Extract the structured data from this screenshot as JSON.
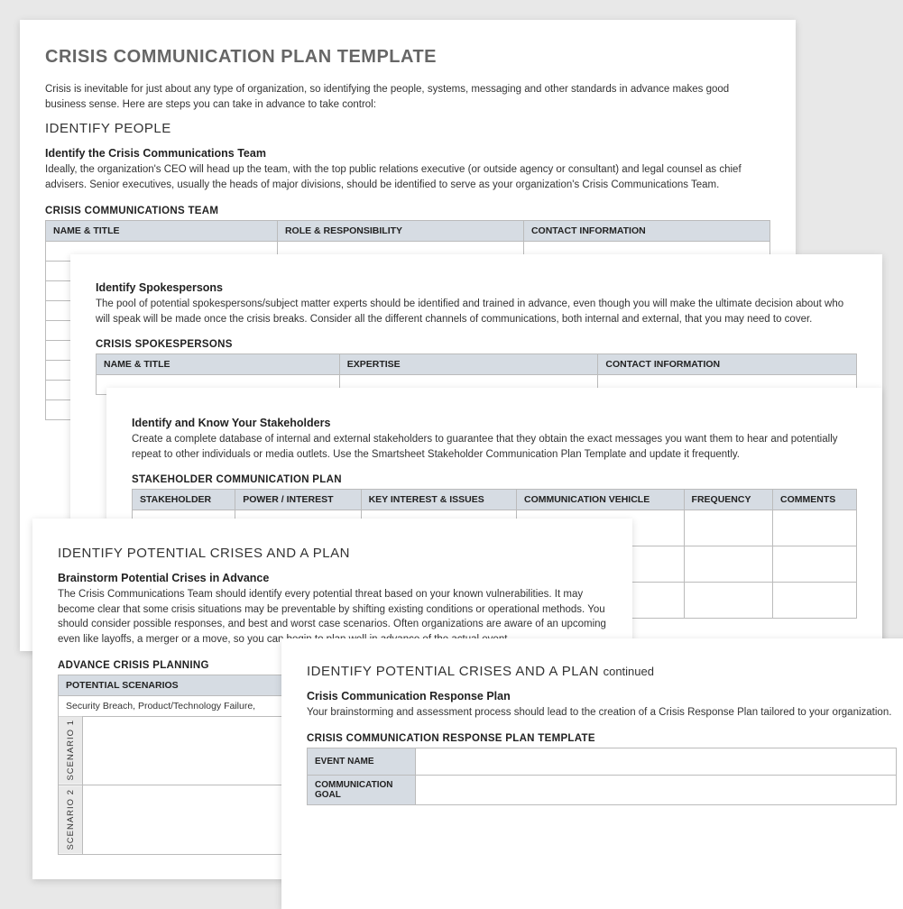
{
  "p1": {
    "title": "CRISIS COMMUNICATION PLAN TEMPLATE",
    "intro": "Crisis is inevitable for just about any type of organization, so identifying the people, systems, messaging and other standards in advance makes good business sense. Here are steps you can take in advance to take control:",
    "sec1": "IDENTIFY PEOPLE",
    "sub1": "Identify the Crisis Communications Team",
    "body1": "Ideally, the organization's CEO will head up the team, with the top public relations executive (or outside agency or consultant) and legal counsel as chief advisers. Senior executives, usually the heads of major divisions, should be identified to serve as your organization's Crisis Communications Team.",
    "tbl1_title": "CRISIS COMMUNICATIONS TEAM",
    "tbl1_h1": "NAME & TITLE",
    "tbl1_h2": "ROLE & RESPONSIBILITY",
    "tbl1_h3": "CONTACT INFORMATION"
  },
  "p2": {
    "sub": "Identify Spokespersons",
    "body": "The pool of potential spokespersons/subject matter experts should be identified and trained in advance, even though you will make the ultimate decision about who will speak will be made once the crisis breaks. Consider all the different channels of communications, both internal and external, that you may need to cover.",
    "tbl_title": "CRISIS SPOKESPERSONS",
    "h1": "NAME & TITLE",
    "h2": "EXPERTISE",
    "h3": "CONTACT INFORMATION"
  },
  "p3": {
    "sub": "Identify and Know Your Stakeholders",
    "body": "Create a complete database of internal and external stakeholders to guarantee that they obtain the exact messages you want them to hear and potentially repeat to other individuals or media outlets. Use the Smartsheet Stakeholder Communication Plan Template and update it frequently.",
    "tbl_title": "STAKEHOLDER COMMUNICATION PLAN",
    "h1": "STAKEHOLDER",
    "h2": "POWER / INTEREST",
    "h3": "KEY INTEREST & ISSUES",
    "h4": "COMMUNICATION VEHICLE",
    "h5": "FREQUENCY",
    "h6": "COMMENTS"
  },
  "p4": {
    "sec": "IDENTIFY POTENTIAL CRISES AND A PLAN",
    "sub": "Brainstorm Potential Crises in Advance",
    "body": "The Crisis Communications Team should identify every potential threat based on your known vulnerabilities. It may become clear that some crisis situations may be preventable by shifting existing conditions or operational methods. You should consider possible responses, and best and worst case scenarios. Often organizations are aware of an upcoming even like layoffs, a merger or a move, so you can begin to plan well in advance of the actual event.",
    "tbl_title": "ADVANCE CRISIS PLANNING",
    "h1": "POTENTIAL SCENARIOS",
    "row1": "Security Breach, Product/Technology Failure,",
    "s1": "SCENARIO 1",
    "s2": "SCENARIO 2"
  },
  "p5": {
    "sec": "IDENTIFY POTENTIAL CRISES AND A PLAN",
    "cont": "continued",
    "sub": "Crisis Communication Response Plan",
    "body": "Your brainstorming and assessment process should lead to the creation of a Crisis Response Plan tailored to your organization.",
    "tbl_title": "CRISIS COMMUNICATION RESPONSE PLAN TEMPLATE",
    "r1": "EVENT NAME",
    "r2": "COMMUNICATION GOAL"
  }
}
